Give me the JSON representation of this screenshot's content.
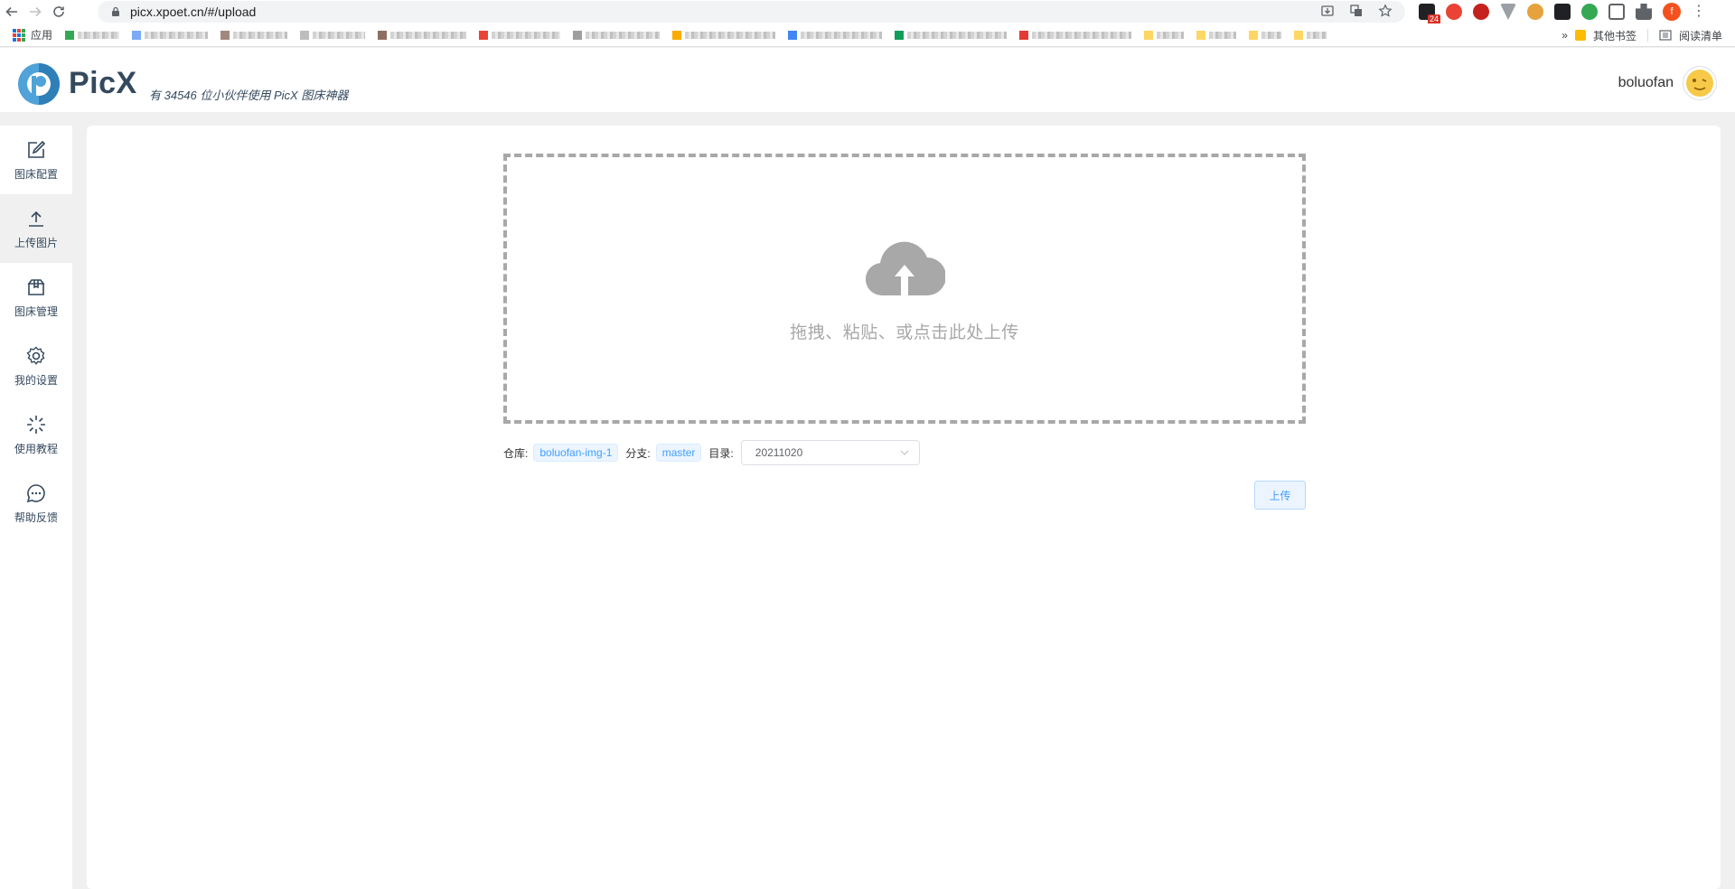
{
  "browser": {
    "url": "picx.xpoet.cn/#/upload",
    "bookmarks_apps_label": "应用",
    "other_bookmarks_label": "其他书签",
    "reading_list_label": "阅读清单",
    "extension_badge": "24",
    "profile_initial": "f",
    "more_bookmarks_glyph": "»"
  },
  "header": {
    "brand": "PicX",
    "tagline": "有 34546 位小伙伴使用 PicX 图床神器",
    "username": "boluofan"
  },
  "sidebar": {
    "items": [
      {
        "label": "图床配置",
        "icon": "edit-icon"
      },
      {
        "label": "上传图片",
        "icon": "upload-icon"
      },
      {
        "label": "图床管理",
        "icon": "box-icon"
      },
      {
        "label": "我的设置",
        "icon": "gear-icon"
      },
      {
        "label": "使用教程",
        "icon": "spark-icon"
      },
      {
        "label": "帮助反馈",
        "icon": "chat-icon"
      }
    ],
    "active_index": 1
  },
  "upload": {
    "drop_text": "拖拽、粘贴、或点击此处上传",
    "repo_label": "仓库:",
    "repo_value": "boluofan-img-1",
    "branch_label": "分支:",
    "branch_value": "master",
    "dir_label": "目录:",
    "dir_value": "20211020",
    "upload_button": "上传"
  },
  "colors": {
    "brand": "#34495e",
    "accent": "#409eff",
    "dropzone_border": "#a8a8a8"
  }
}
